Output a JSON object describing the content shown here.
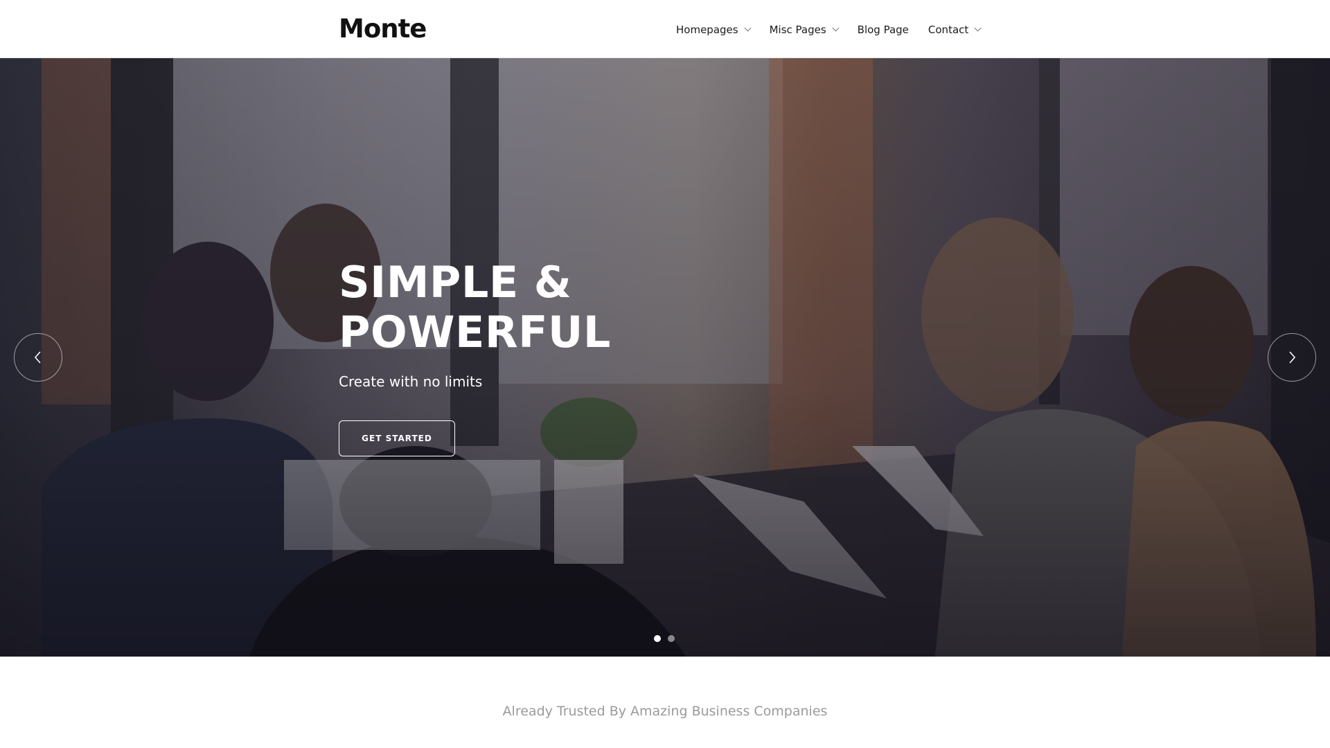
{
  "header": {
    "logo": "Monte",
    "nav": [
      {
        "label": "Homepages",
        "has_dropdown": true
      },
      {
        "label": "Misc Pages",
        "has_dropdown": true
      },
      {
        "label": "Blog Page",
        "has_dropdown": false
      },
      {
        "label": "Contact",
        "has_dropdown": true
      }
    ]
  },
  "hero": {
    "title_line1": "SIMPLE &",
    "title_line2": "POWERFUL",
    "subtitle": "Create with no limits",
    "cta_label": "GET STARTED",
    "prev_icon": "chevron-left-icon",
    "next_icon": "chevron-right-icon",
    "slides_total": 2,
    "active_slide": 1
  },
  "trusted": {
    "text": "Already Trusted By Amazing Business Companies"
  },
  "colors": {
    "text_dark": "#1a1a1a",
    "muted": "#9a9a9a",
    "white": "#ffffff"
  }
}
